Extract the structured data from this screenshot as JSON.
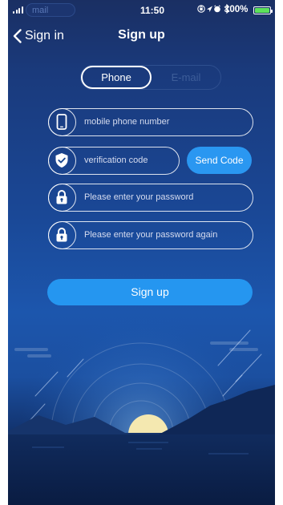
{
  "colors": {
    "accent": "#2596f0",
    "background_top": "#1a2f63",
    "background_bottom": "#0b1f47",
    "battery": "#5ce25a"
  },
  "status_bar": {
    "carrier": "mail",
    "time": "11:50",
    "icons": [
      "orientation-lock-icon",
      "location-icon",
      "alarm-icon",
      "bluetooth-icon"
    ],
    "battery_percent": "100%",
    "battery_level": 1.0
  },
  "nav": {
    "back_label": "Sign in",
    "title": "Sign up"
  },
  "tabs": {
    "phone": "Phone",
    "email": "E-mail",
    "selected": "Phone"
  },
  "form": {
    "phone_placeholder": "mobile phone number",
    "code_placeholder": "verification code",
    "send_code_label": "Send Code",
    "password_placeholder": "Please enter your password",
    "password_again_placeholder": "Please enter your password again",
    "submit_label": "Sign up"
  }
}
